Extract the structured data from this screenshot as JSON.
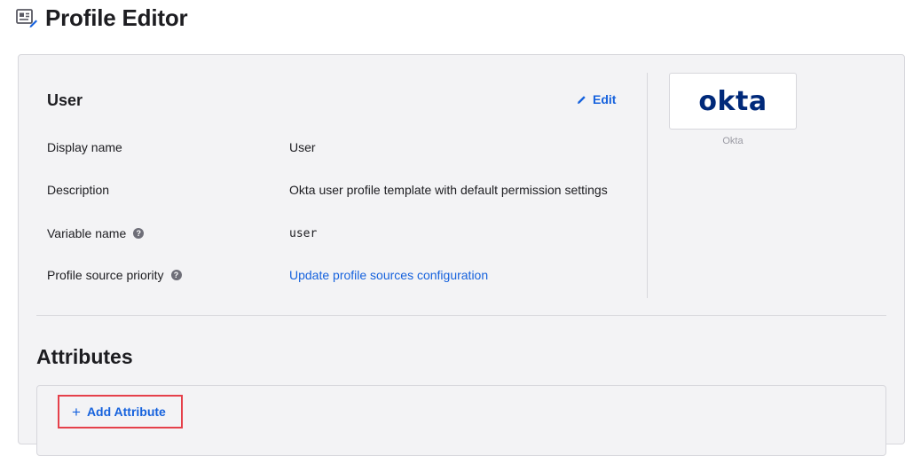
{
  "page": {
    "title": "Profile Editor",
    "icon": "profile-card-edit-icon"
  },
  "profile": {
    "card_title": "User",
    "edit_label": "Edit",
    "rows": [
      {
        "label": "Display name",
        "value": "User",
        "help": false
      },
      {
        "label": "Description",
        "value": "Okta user profile template with default permission settings",
        "help": false
      },
      {
        "label": "Variable name",
        "value": "user",
        "help": true
      },
      {
        "label": "Profile source priority",
        "value": "Update profile sources configuration",
        "help": true
      }
    ],
    "help_glyph": "?",
    "logo": {
      "text": "okta",
      "caption": "Okta",
      "color": "#00297a"
    }
  },
  "attributes": {
    "title": "Attributes",
    "add_label": "Add Attribute",
    "add_glyph": "+"
  },
  "colors": {
    "link": "#1662dd",
    "highlight_border": "#e5404a",
    "panel_bg": "#f3f3f5"
  }
}
